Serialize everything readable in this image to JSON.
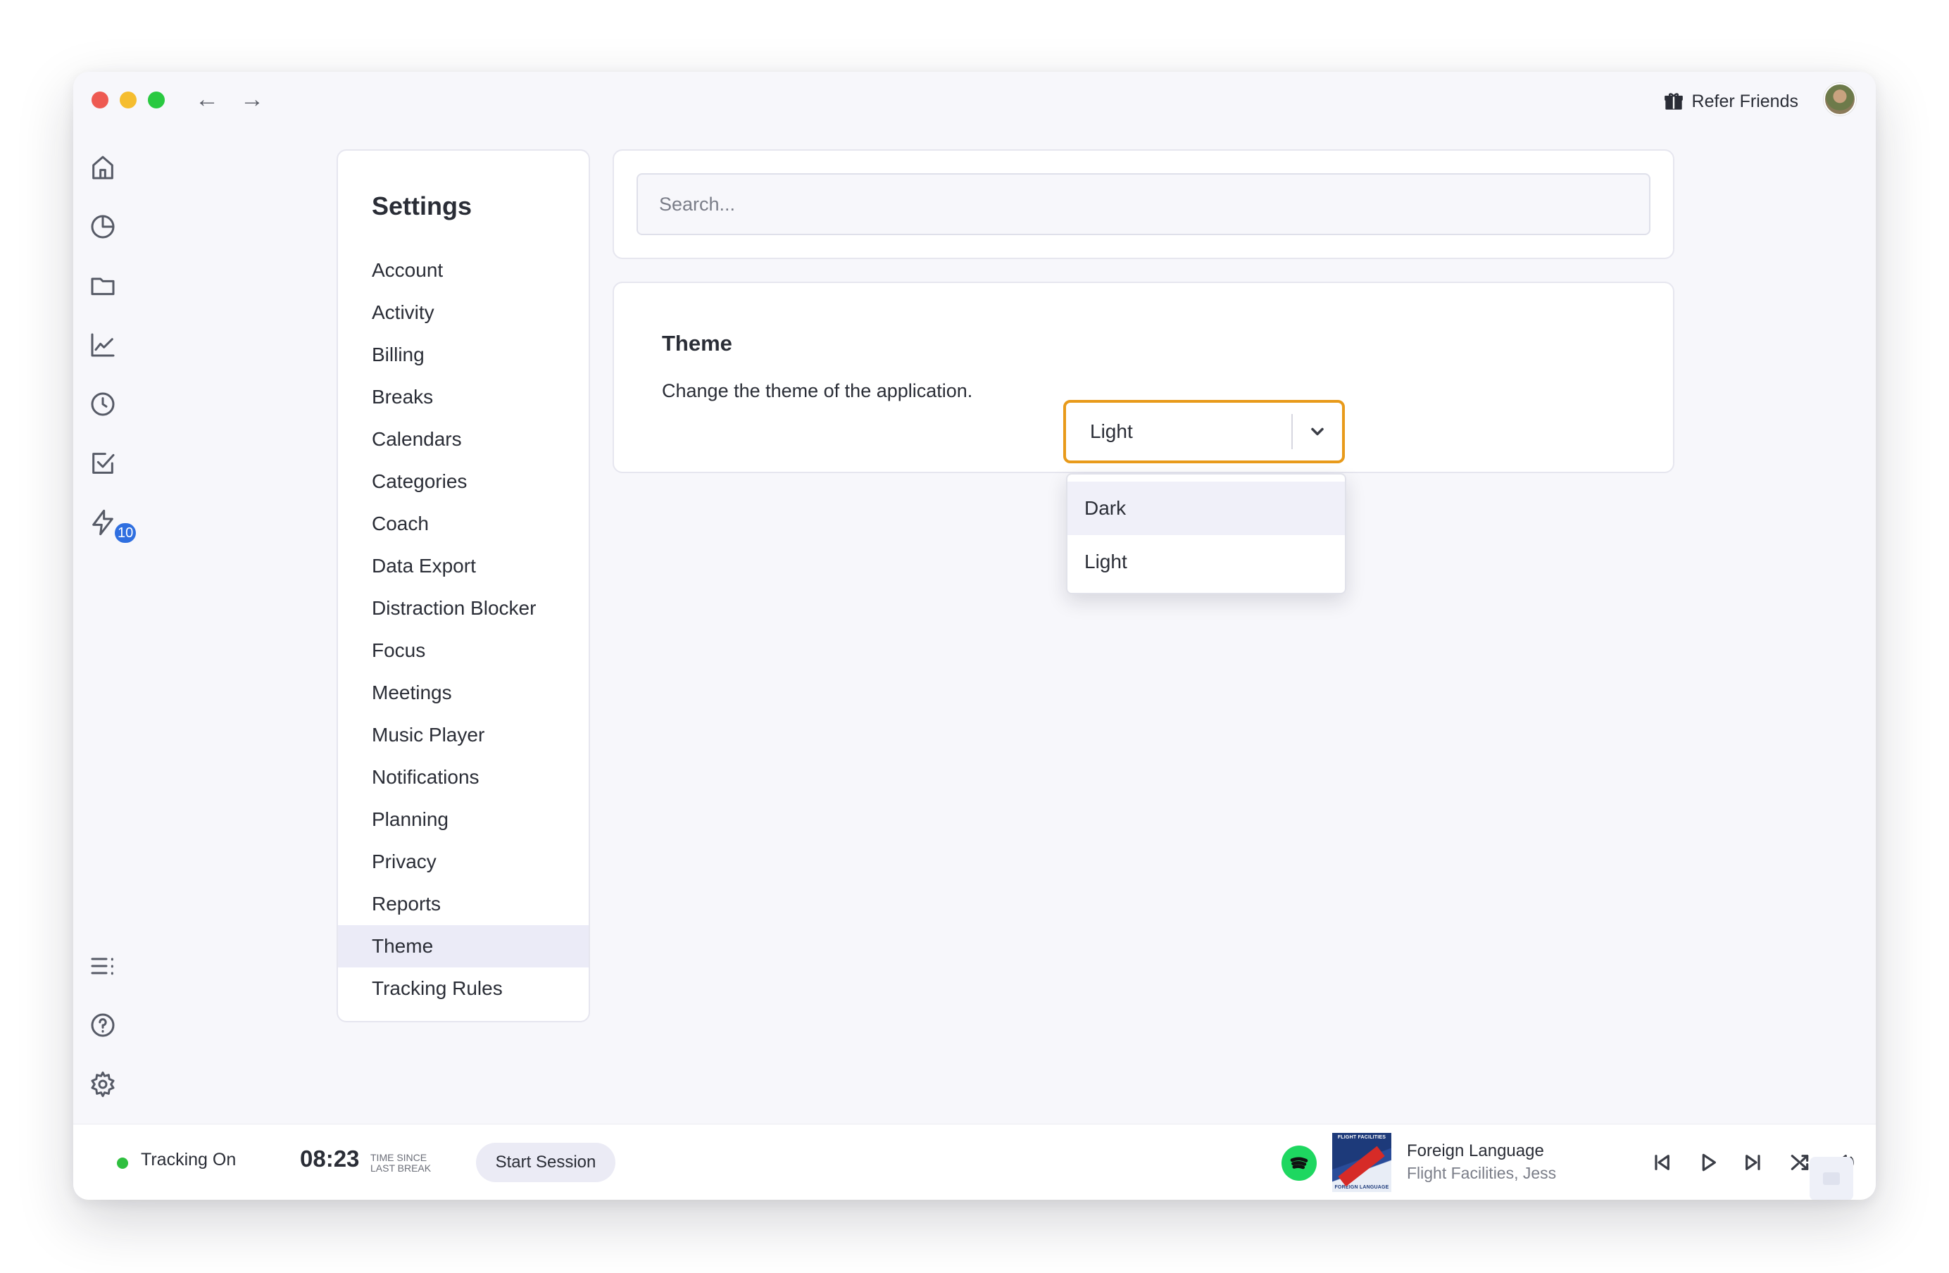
{
  "titlebar": {
    "refer_label": "Refer Friends"
  },
  "rail": {
    "badge_count": "10"
  },
  "settings": {
    "title": "Settings",
    "items": [
      "Account",
      "Activity",
      "Billing",
      "Breaks",
      "Calendars",
      "Categories",
      "Coach",
      "Data Export",
      "Distraction Blocker",
      "Focus",
      "Meetings",
      "Music Player",
      "Notifications",
      "Planning",
      "Privacy",
      "Reports",
      "Theme",
      "Tracking Rules"
    ],
    "active_item": "Theme"
  },
  "search": {
    "placeholder": "Search..."
  },
  "theme": {
    "title": "Theme",
    "description": "Change the theme of the application.",
    "selected": "Light",
    "options": [
      "Dark",
      "Light"
    ],
    "highlighted_option": "Dark",
    "focus_color": "#e89a1a"
  },
  "bottom": {
    "tracking_label": "Tracking On",
    "tracking_color": "#2fbf3f",
    "timer": "08:23",
    "timer_caption_1": "TIME SINCE",
    "timer_caption_2": "LAST BREAK",
    "start_label": "Start Session",
    "track_title": "Foreign Language",
    "track_artist": "Flight Facilities, Jess",
    "album_top_text": "FLIGHT FACILITIES",
    "album_bottom_text": "FOREIGN LANGUAGE"
  }
}
